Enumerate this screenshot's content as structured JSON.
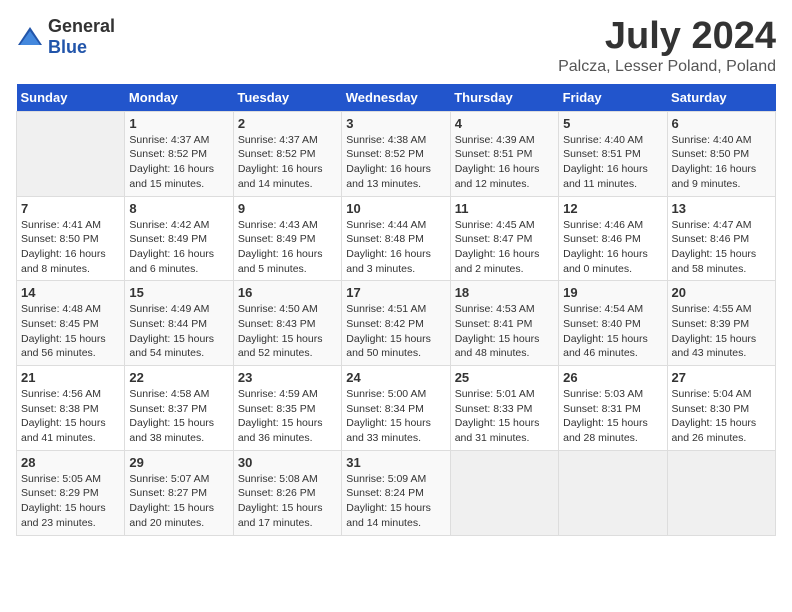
{
  "logo": {
    "general": "General",
    "blue": "Blue"
  },
  "title": "July 2024",
  "subtitle": "Palcza, Lesser Poland, Poland",
  "days_header": [
    "Sunday",
    "Monday",
    "Tuesday",
    "Wednesday",
    "Thursday",
    "Friday",
    "Saturday"
  ],
  "weeks": [
    [
      {
        "num": "",
        "detail": ""
      },
      {
        "num": "1",
        "detail": "Sunrise: 4:37 AM\nSunset: 8:52 PM\nDaylight: 16 hours and 15 minutes."
      },
      {
        "num": "2",
        "detail": "Sunrise: 4:37 AM\nSunset: 8:52 PM\nDaylight: 16 hours and 14 minutes."
      },
      {
        "num": "3",
        "detail": "Sunrise: 4:38 AM\nSunset: 8:52 PM\nDaylight: 16 hours and 13 minutes."
      },
      {
        "num": "4",
        "detail": "Sunrise: 4:39 AM\nSunset: 8:51 PM\nDaylight: 16 hours and 12 minutes."
      },
      {
        "num": "5",
        "detail": "Sunrise: 4:40 AM\nSunset: 8:51 PM\nDaylight: 16 hours and 11 minutes."
      },
      {
        "num": "6",
        "detail": "Sunrise: 4:40 AM\nSunset: 8:50 PM\nDaylight: 16 hours and 9 minutes."
      }
    ],
    [
      {
        "num": "7",
        "detail": "Sunrise: 4:41 AM\nSunset: 8:50 PM\nDaylight: 16 hours and 8 minutes."
      },
      {
        "num": "8",
        "detail": "Sunrise: 4:42 AM\nSunset: 8:49 PM\nDaylight: 16 hours and 6 minutes."
      },
      {
        "num": "9",
        "detail": "Sunrise: 4:43 AM\nSunset: 8:49 PM\nDaylight: 16 hours and 5 minutes."
      },
      {
        "num": "10",
        "detail": "Sunrise: 4:44 AM\nSunset: 8:48 PM\nDaylight: 16 hours and 3 minutes."
      },
      {
        "num": "11",
        "detail": "Sunrise: 4:45 AM\nSunset: 8:47 PM\nDaylight: 16 hours and 2 minutes."
      },
      {
        "num": "12",
        "detail": "Sunrise: 4:46 AM\nSunset: 8:46 PM\nDaylight: 16 hours and 0 minutes."
      },
      {
        "num": "13",
        "detail": "Sunrise: 4:47 AM\nSunset: 8:46 PM\nDaylight: 15 hours and 58 minutes."
      }
    ],
    [
      {
        "num": "14",
        "detail": "Sunrise: 4:48 AM\nSunset: 8:45 PM\nDaylight: 15 hours and 56 minutes."
      },
      {
        "num": "15",
        "detail": "Sunrise: 4:49 AM\nSunset: 8:44 PM\nDaylight: 15 hours and 54 minutes."
      },
      {
        "num": "16",
        "detail": "Sunrise: 4:50 AM\nSunset: 8:43 PM\nDaylight: 15 hours and 52 minutes."
      },
      {
        "num": "17",
        "detail": "Sunrise: 4:51 AM\nSunset: 8:42 PM\nDaylight: 15 hours and 50 minutes."
      },
      {
        "num": "18",
        "detail": "Sunrise: 4:53 AM\nSunset: 8:41 PM\nDaylight: 15 hours and 48 minutes."
      },
      {
        "num": "19",
        "detail": "Sunrise: 4:54 AM\nSunset: 8:40 PM\nDaylight: 15 hours and 46 minutes."
      },
      {
        "num": "20",
        "detail": "Sunrise: 4:55 AM\nSunset: 8:39 PM\nDaylight: 15 hours and 43 minutes."
      }
    ],
    [
      {
        "num": "21",
        "detail": "Sunrise: 4:56 AM\nSunset: 8:38 PM\nDaylight: 15 hours and 41 minutes."
      },
      {
        "num": "22",
        "detail": "Sunrise: 4:58 AM\nSunset: 8:37 PM\nDaylight: 15 hours and 38 minutes."
      },
      {
        "num": "23",
        "detail": "Sunrise: 4:59 AM\nSunset: 8:35 PM\nDaylight: 15 hours and 36 minutes."
      },
      {
        "num": "24",
        "detail": "Sunrise: 5:00 AM\nSunset: 8:34 PM\nDaylight: 15 hours and 33 minutes."
      },
      {
        "num": "25",
        "detail": "Sunrise: 5:01 AM\nSunset: 8:33 PM\nDaylight: 15 hours and 31 minutes."
      },
      {
        "num": "26",
        "detail": "Sunrise: 5:03 AM\nSunset: 8:31 PM\nDaylight: 15 hours and 28 minutes."
      },
      {
        "num": "27",
        "detail": "Sunrise: 5:04 AM\nSunset: 8:30 PM\nDaylight: 15 hours and 26 minutes."
      }
    ],
    [
      {
        "num": "28",
        "detail": "Sunrise: 5:05 AM\nSunset: 8:29 PM\nDaylight: 15 hours and 23 minutes."
      },
      {
        "num": "29",
        "detail": "Sunrise: 5:07 AM\nSunset: 8:27 PM\nDaylight: 15 hours and 20 minutes."
      },
      {
        "num": "30",
        "detail": "Sunrise: 5:08 AM\nSunset: 8:26 PM\nDaylight: 15 hours and 17 minutes."
      },
      {
        "num": "31",
        "detail": "Sunrise: 5:09 AM\nSunset: 8:24 PM\nDaylight: 15 hours and 14 minutes."
      },
      {
        "num": "",
        "detail": ""
      },
      {
        "num": "",
        "detail": ""
      },
      {
        "num": "",
        "detail": ""
      }
    ]
  ]
}
